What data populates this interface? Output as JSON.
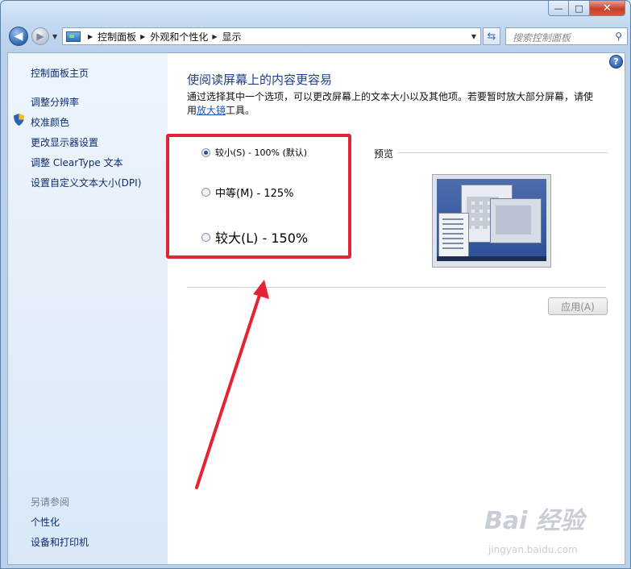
{
  "window": {
    "caption": {
      "minimize": "—",
      "maximize": "□",
      "close": "✕"
    }
  },
  "navbar": {
    "breadcrumbs": [
      "控制面板",
      "外观和个性化",
      "显示"
    ],
    "search_placeholder": "搜索控制面板"
  },
  "sidebar": {
    "items": [
      "控制面板主页",
      "调整分辨率",
      "校准颜色",
      "更改显示器设置",
      "调整 ClearType 文本",
      "设置自定义文本大小(DPI)"
    ],
    "see_also_label": "另请参阅",
    "see_also": [
      "个性化",
      "设备和打印机"
    ]
  },
  "main": {
    "heading": "使阅读屏幕上的内容更容易",
    "desc_text": "通过选择其中一个选项，可以更改屏幕上的文本大小以及其他项。若要暂时放大部分屏幕，请使用",
    "desc_link": "放大镜",
    "desc_tail": "工具。",
    "options": [
      {
        "label": "较小(S) - 100% (默认)",
        "checked": true
      },
      {
        "label": "中等(M) - 125%",
        "checked": false
      },
      {
        "label": "较大(L) - 150%",
        "checked": false
      }
    ],
    "preview_label": "预览",
    "apply_label": "应用(A)"
  },
  "watermark": {
    "brand": "Bai 经验",
    "url": "jingyan.baidu.com"
  },
  "colors": {
    "annotation_red": "#e52335",
    "link_blue": "#1a57b8",
    "heading_blue": "#1e3f8a"
  }
}
